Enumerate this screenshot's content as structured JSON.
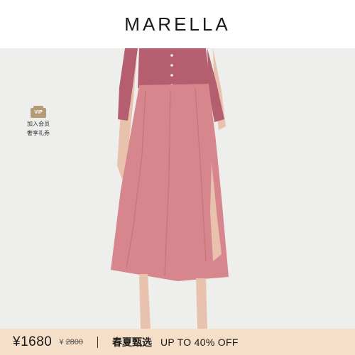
{
  "header": {
    "brand": "MARELLA"
  },
  "vip": {
    "badge": "VIP",
    "line1": "加入会员",
    "line2": "奢享礼券"
  },
  "product_image": {
    "icon": "model-in-pink-skirt-photo",
    "colors": {
      "skirt": "#d6868c",
      "cardigan": "#b45e6f",
      "background": "#eeeeec"
    }
  },
  "footer": {
    "price": "¥1680",
    "original_prefix": "¥",
    "original_price": "2800",
    "promo_cn": "春夏甄选",
    "promo_en": "UP TO 40% OFF",
    "colors": {
      "banner": "#f6dfc8"
    }
  }
}
